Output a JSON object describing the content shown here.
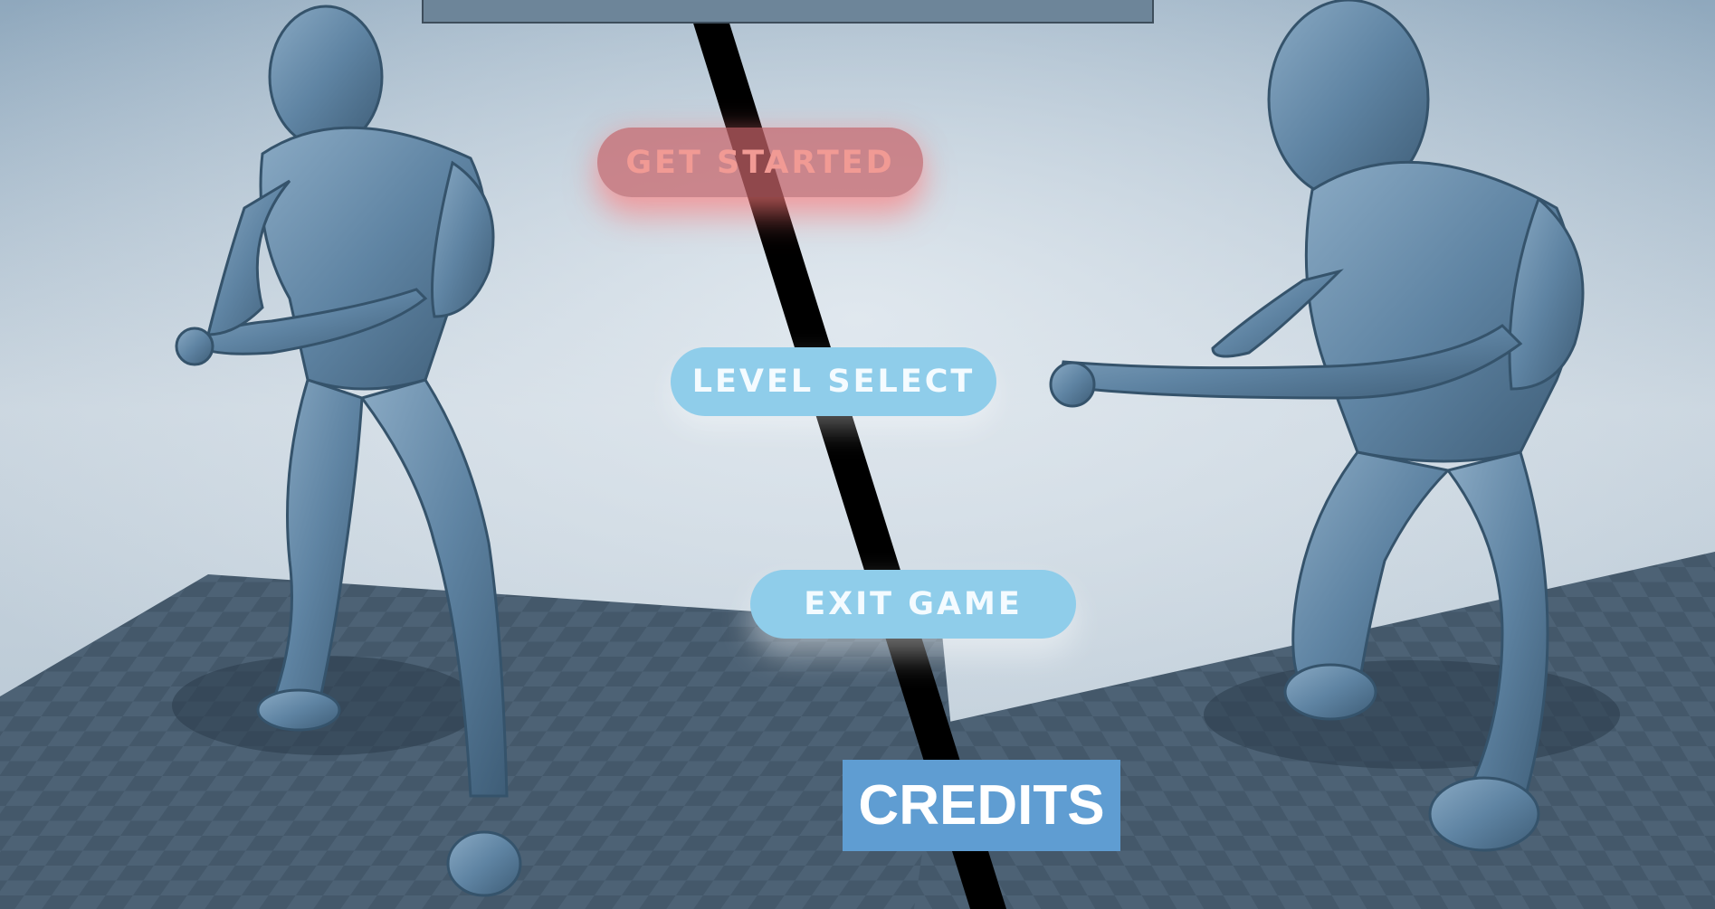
{
  "menu": {
    "get_started_label": "GET STARTED",
    "level_select_label": "LEVEL SELECT",
    "exit_game_label": "EXIT GAME",
    "credits_label": "CREDITS"
  },
  "colors": {
    "get_started_bg": "#c8646a",
    "get_started_text": "#f19a94",
    "menu_button_bg": "#8fcdea",
    "credits_bg": "#5f9dd2",
    "divider": "#000000"
  }
}
